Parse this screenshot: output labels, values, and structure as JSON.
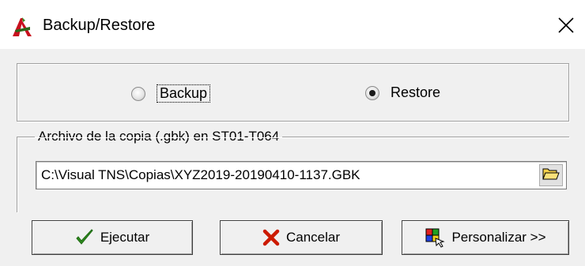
{
  "window": {
    "title": "Backup/Restore",
    "close_glyph": "✕"
  },
  "mode": {
    "options": [
      {
        "label": "Backup",
        "checked": false
      },
      {
        "label": "Restore",
        "checked": true
      }
    ]
  },
  "file": {
    "legend": "Archivo de la copia (.gbk) en ST01-T064",
    "path": "C:\\Visual TNS\\Copias\\XYZ2019-20190410-1137.GBK"
  },
  "buttons": {
    "execute": "Ejecutar",
    "cancel": "Cancelar",
    "customize": "Personalizar >>"
  },
  "icons": {
    "app": "app-logo-icon",
    "browse": "folder-open-icon",
    "execute": "checkmark-icon",
    "cancel": "x-mark-icon",
    "customize": "customize-icon"
  },
  "colors": {
    "checkmark": "#2e8b1e",
    "cancel": "#cc1a00",
    "folder": "#f5d04a"
  }
}
